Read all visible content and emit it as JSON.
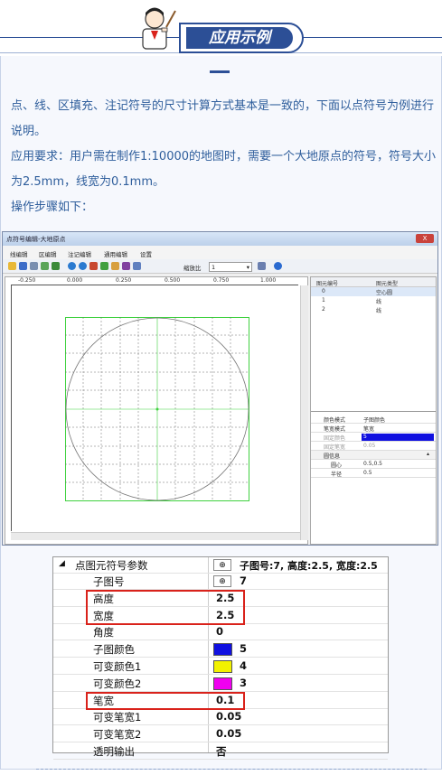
{
  "header": {
    "badge": "应用示例"
  },
  "paragraphs": [
    "点、线、区填充、注记符号的尺寸计算方式基本是一致的，下面以点符号为例进行说明。",
    "应用要求：用户需在制作1:10000的地图时，需要一个大地原点的符号，符号大小为2.5mm，线宽为0.1mm。",
    "操作步骤如下："
  ],
  "editor": {
    "title": "点符号编辑-大地原点",
    "close": "X",
    "menu": [
      "线编辑",
      "区编辑",
      "注记编辑",
      "通用编辑",
      "设置"
    ],
    "zoom_label": "缩放比",
    "zoom_value": "1",
    "ruler_h": [
      "-0.250",
      "0.000",
      "0.250",
      "0.500",
      "0.750",
      "1.000"
    ],
    "ruler_v": [
      "1.000",
      "0.750",
      "0.500",
      "0.250",
      "0.000"
    ],
    "elements_header": [
      "图元编号",
      "图元类型"
    ],
    "elements": [
      {
        "id": "0",
        "type": "空心圆"
      },
      {
        "id": "1",
        "type": "线"
      },
      {
        "id": "2",
        "type": "线"
      }
    ],
    "props": [
      {
        "k": "颜色模式",
        "v": "子图颜色"
      },
      {
        "k": "笔宽模式",
        "v": "笔宽"
      },
      {
        "k": "固定颜色",
        "v": "5"
      },
      {
        "k": "固定笔宽",
        "v": "0.05"
      },
      {
        "k": "圆信息",
        "v": ""
      },
      {
        "k": "圆心",
        "v": "0.5,0.5"
      },
      {
        "k": "半径",
        "v": "0.5"
      }
    ]
  },
  "params": {
    "group_label": "点图元符号参数",
    "group_value": "子图号:7, 高度:2.5, 宽度:2.5",
    "rows": [
      {
        "label": "子图号",
        "value": "7"
      },
      {
        "label": "高度",
        "value": "2.5"
      },
      {
        "label": "宽度",
        "value": "2.5"
      },
      {
        "label": "角度",
        "value": "0"
      },
      {
        "label": "子图颜色",
        "value": "5",
        "color": "#1010e0"
      },
      {
        "label": "可变颜色1",
        "value": "4",
        "color": "#f2f200"
      },
      {
        "label": "可变颜色2",
        "value": "3",
        "color": "#f000f0"
      },
      {
        "label": "笔宽",
        "value": "0.1"
      },
      {
        "label": "可变笔宽1",
        "value": "0.05"
      },
      {
        "label": "可变笔宽2",
        "value": "0.05"
      },
      {
        "label": "透明输出",
        "value": "否"
      }
    ]
  },
  "colors": {
    "accent": "#2c4f96",
    "highlight": "#d9221b",
    "grid": "#3fd13f"
  }
}
